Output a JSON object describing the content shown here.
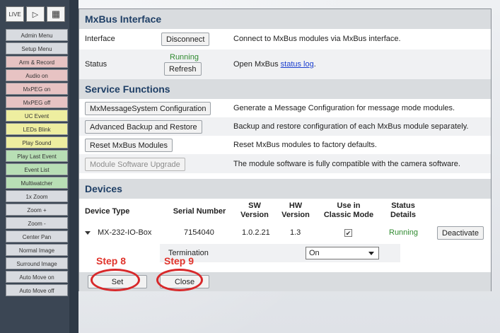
{
  "sidebar": {
    "top_buttons": [
      {
        "name": "live-icon",
        "glyph": "LIVE"
      },
      {
        "name": "play-icon",
        "glyph": "▷"
      },
      {
        "name": "grid-icon",
        "glyph": "▦"
      }
    ],
    "items": [
      {
        "label": "Admin Menu",
        "color": "gray"
      },
      {
        "label": "Setup Menu",
        "color": "gray"
      },
      {
        "label": "Arm & Record",
        "color": "pink"
      },
      {
        "label": "Audio on",
        "color": "pink"
      },
      {
        "label": "MxPEG on",
        "color": "pink"
      },
      {
        "label": "MxPEG off",
        "color": "pink"
      },
      {
        "label": "UC Event",
        "color": "yellow"
      },
      {
        "label": "LEDs Blink",
        "color": "yellow"
      },
      {
        "label": "Play Sound",
        "color": "yellow"
      },
      {
        "label": "Play Last Event",
        "color": "green"
      },
      {
        "label": "Event List",
        "color": "green"
      },
      {
        "label": "Multiwatcher",
        "color": "green"
      },
      {
        "label": "1x Zoom",
        "color": "gray"
      },
      {
        "label": "Zoom +",
        "color": "gray"
      },
      {
        "label": "Zoom -",
        "color": "gray"
      },
      {
        "label": "Center Pan",
        "color": "gray"
      },
      {
        "label": "Normal Image",
        "color": "gray"
      },
      {
        "label": "Surround Image",
        "color": "gray"
      },
      {
        "label": "Auto Move on",
        "color": "gray"
      },
      {
        "label": "Auto Move off",
        "color": "gray"
      }
    ]
  },
  "mxbus": {
    "title": "MxBus Interface",
    "interface_label": "Interface",
    "disconnect_button": "Disconnect",
    "interface_desc": "Connect to MxBus modules via MxBus interface.",
    "status_label": "Status",
    "status_value": "Running",
    "refresh_button": "Refresh",
    "status_desc_prefix": "Open MxBus ",
    "status_link": "status log",
    "status_desc_suffix": "."
  },
  "services": {
    "title": "Service Functions",
    "rows": [
      {
        "button": "MxMessageSystem Configuration",
        "desc": "Generate a Message Configuration for message mode modules."
      },
      {
        "button": "Advanced Backup and Restore",
        "desc": "Backup and restore configuration of each MxBus module separately."
      },
      {
        "button": "Reset MxBus Modules",
        "desc": "Reset MxBus modules to factory defaults."
      },
      {
        "button": "Module Software Upgrade",
        "desc": "The module software is fully compatible with the camera software."
      }
    ]
  },
  "devices": {
    "title": "Devices",
    "columns": {
      "device_type": "Device Type",
      "serial": "Serial Number",
      "sw_1": "SW",
      "sw_2": "Version",
      "hw_1": "HW",
      "hw_2": "Version",
      "classic_1": "Use in",
      "classic_2": "Classic Mode",
      "status_1": "Status",
      "status_2": "Details"
    },
    "device": {
      "type": "MX-232-IO-Box",
      "serial": "7154040",
      "sw_version": "1.0.2.21",
      "hw_version": "1.3",
      "classic_checked": "✔",
      "status": "Running",
      "action": "Deactivate"
    },
    "termination_label": "Termination",
    "termination_value": "On"
  },
  "footer": {
    "set_button": "Set",
    "close_button": "Close"
  },
  "annotations": {
    "step8": "Step 8",
    "step9": "Step 9",
    "color": "#e0332b"
  }
}
